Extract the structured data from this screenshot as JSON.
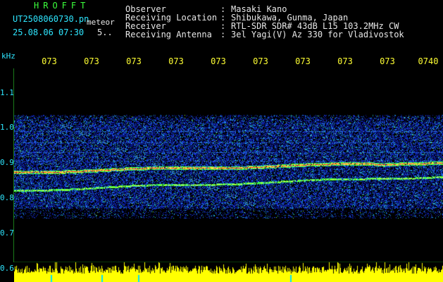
{
  "header": {
    "app_title": "HROFFT",
    "file_name": "UT2508060730.pn",
    "file_suffix": "meteor",
    "date_time": "25.08.06 07:30",
    "extra_value": "5.."
  },
  "info": [
    {
      "label": "Observer",
      "value": "Masaki Kano"
    },
    {
      "label": "Receiving Location",
      "value": "Shibukawa, Gunma, Japan"
    },
    {
      "label": "Receiver",
      "value": "RTL-SDR SDR# 43dB L15 103.2MHz CW"
    },
    {
      "label": "Receiving Antenna",
      "value": "3el Yagi(V) Az 330 for Vladivostok"
    }
  ],
  "separator": ":",
  "y_axis": {
    "unit": "kHz",
    "ticks": [
      {
        "label": "1.1",
        "value": 1.1
      },
      {
        "label": "1.0",
        "value": 1.0
      },
      {
        "label": "0.9",
        "value": 0.9
      },
      {
        "label": "0.8",
        "value": 0.8
      },
      {
        "label": "0.7",
        "value": 0.7
      },
      {
        "label": "0.6",
        "value": 0.6
      }
    ]
  },
  "x_axis": {
    "ticks": [
      "073",
      "073",
      "073",
      "073",
      "073",
      "073",
      "073",
      "073",
      "073",
      "0740"
    ]
  },
  "colors": {
    "background": "#000000",
    "noise": "#1428c8",
    "signal_strong": "#ff3c3c",
    "signal_mid": "#3cff3c",
    "meter": "#ffff00",
    "label_green": "#3cff3c",
    "label_cyan": "#2ee6ff",
    "label_yellow": "#ffff33"
  }
}
